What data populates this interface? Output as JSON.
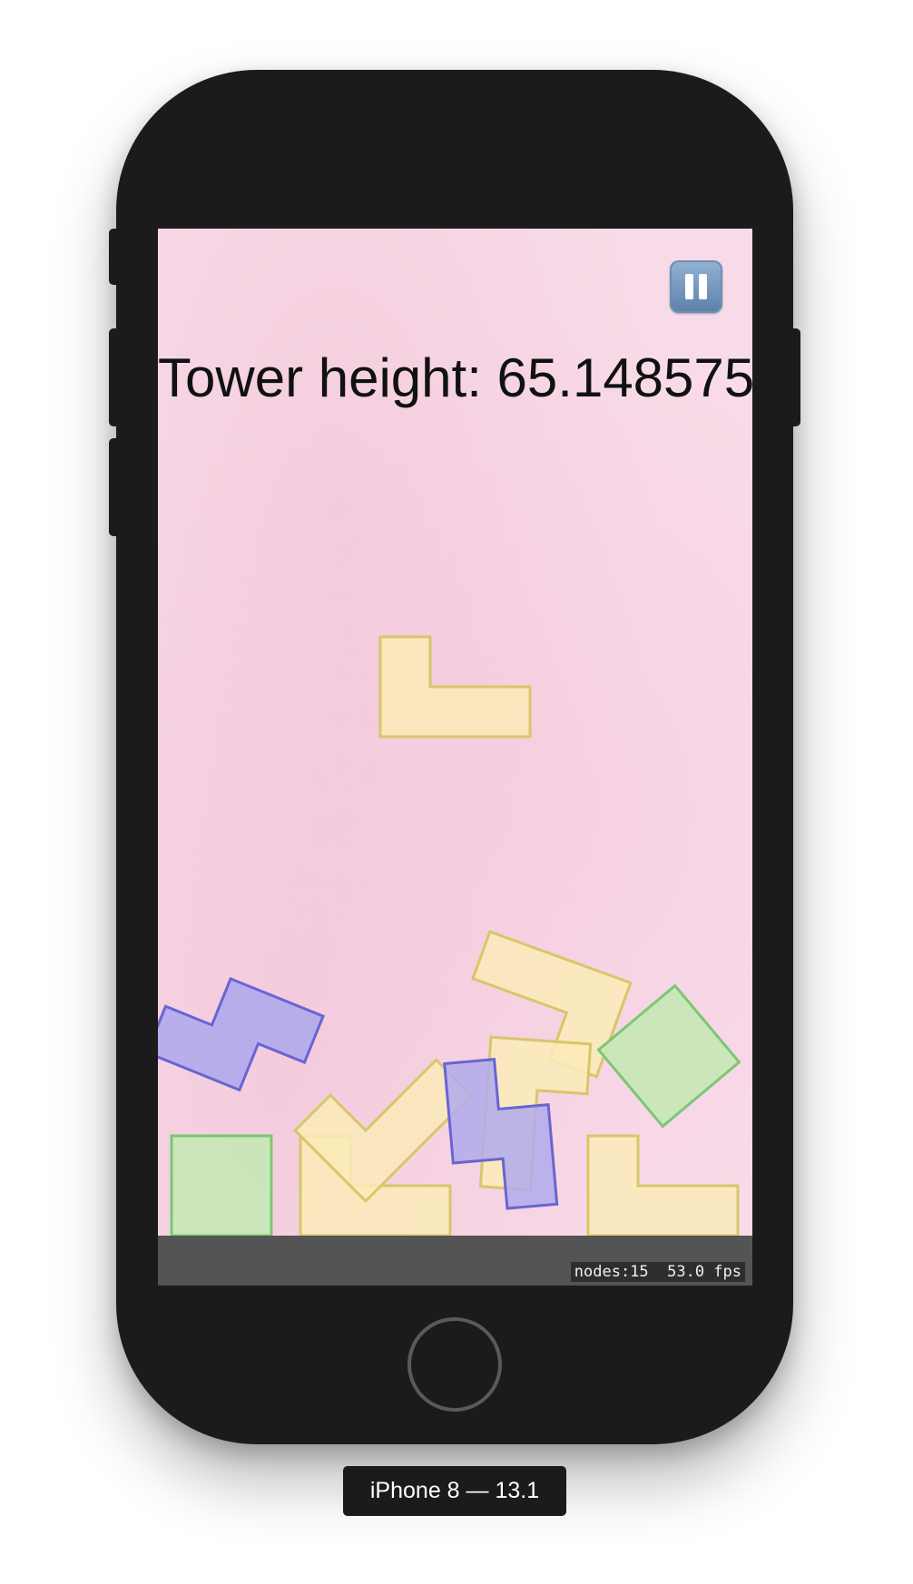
{
  "hud": {
    "score_text": "Tower height: 65.148575",
    "pause_icon": "pause-icon"
  },
  "debug": {
    "stats_text": "nodes:15  53.0 fps"
  },
  "simulator": {
    "device_label": "iPhone 8 — 13.1"
  },
  "colors": {
    "yellow_fill": "#faebb8",
    "yellow_stroke": "#d8c66a",
    "green_fill": "#c6e8b6",
    "green_stroke": "#7cc774",
    "purple_fill": "#b1aaec",
    "purple_stroke": "#6865d2"
  }
}
